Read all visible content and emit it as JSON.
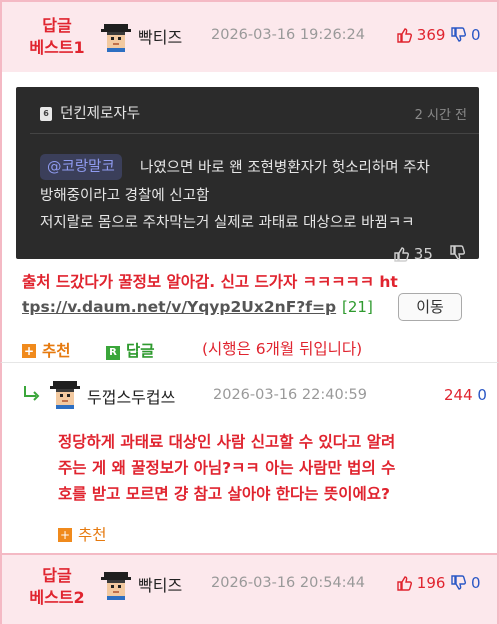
{
  "best1": {
    "label_line1": "답글",
    "label_line2": "베스트1",
    "nickname": "빡티즈",
    "date": "2026-03-16 19:26:24",
    "up": "369",
    "down": "0"
  },
  "embed": {
    "badge": "6",
    "title": "던킨제로자두",
    "time": "2 시간 전",
    "mention": "@코랑말코",
    "line1": "나였으면 바로 왠 조현병환자가 헛소리하며 주차",
    "line2": "방해중이라고 경찰에 신고함",
    "line3": "저지랄로 몸으로 주차막는거 실제로 과태료 대상으로 바뀜ㅋㅋ",
    "likes": "35"
  },
  "main": {
    "text1": "출처 드갔다가 꿀정보 알아감. 신고 드가자 ㅋㅋㅋㅋㅋ ht",
    "text2": "tps://v.daum.net/v/Yqyp2Ux2nF?f=p",
    "refcount": "[21]",
    "move_button": "이동",
    "recommend_label": "추천",
    "reply_label": "답글",
    "reply_badge": "R",
    "note": "(시행은 6개월 뒤입니다)"
  },
  "reply": {
    "nickname": "두껍스두컵쓰",
    "date": "2026-03-16 22:40:59",
    "up": "244",
    "down": "0",
    "line1": "정당하게 과태료 대상인 사람 신고할 수 있다고 알려",
    "line2": "주는 게 왜 꿀정보가 아님?ㅋㅋ 아는 사람만 법의 수",
    "line3": "호를 받고 모르면 걍 참고 살아야 한다는 뜻이에요?",
    "recommend_label": "추천"
  },
  "best2": {
    "label_line1": "답글",
    "label_line2": "베스트2",
    "nickname": "빡티즈",
    "date": "2026-03-16 20:54:44",
    "up": "196",
    "down": "0"
  },
  "colors": {
    "accent_red": "#e0242f",
    "down_blue": "#2a57c5",
    "best_bg": "#fce8ec",
    "embed_bg": "#2b2b2b",
    "recommend_orange": "#e67a0f",
    "reply_green": "#2f9a2f"
  },
  "icons": {
    "thumb_up": "thumb-up-icon",
    "thumb_down": "thumb-down-icon",
    "reply_arrow": "reply-arrow-icon",
    "avatar": "pixel-avatar-icon"
  }
}
